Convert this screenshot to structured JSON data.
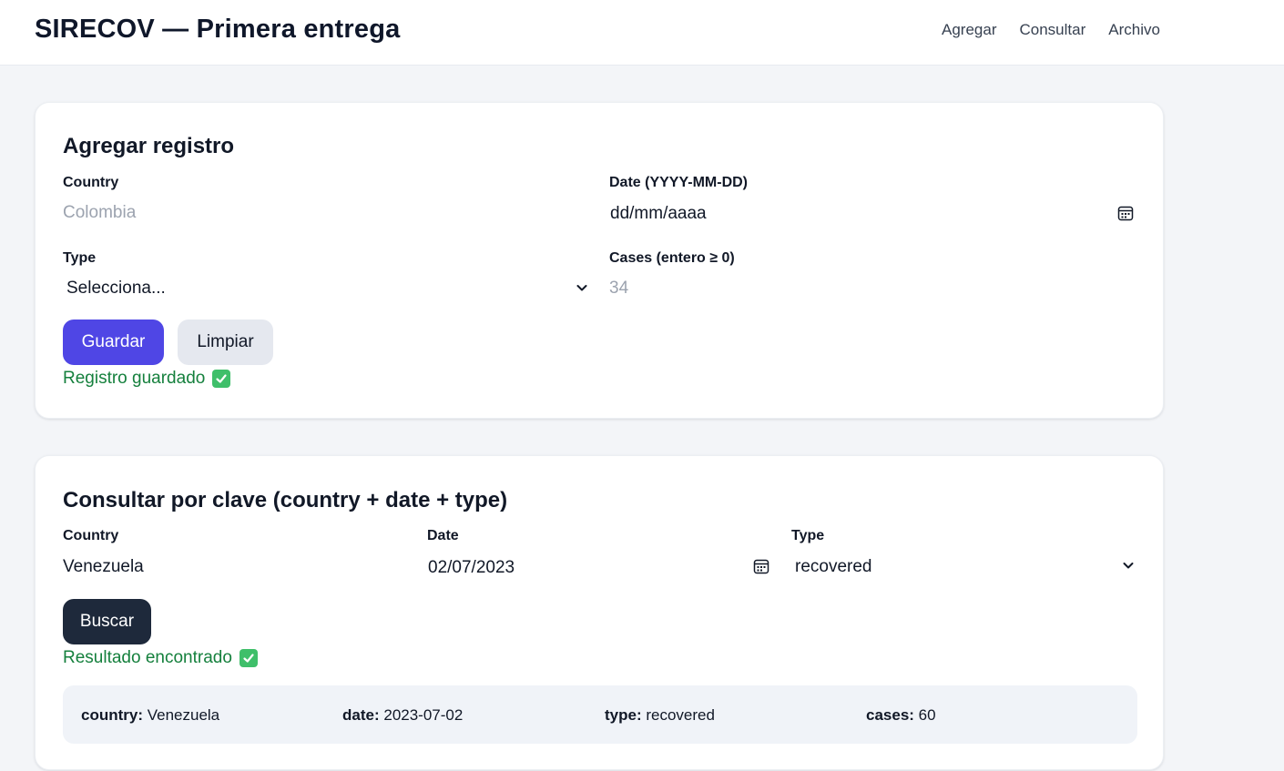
{
  "header": {
    "title": "SIRECOV — Primera entrega",
    "nav": [
      "Agregar",
      "Consultar",
      "Archivo"
    ]
  },
  "add_form": {
    "title": "Agregar registro",
    "country_label": "Country",
    "country_placeholder": "Colombia",
    "date_label": "Date (YYYY-MM-DD)",
    "date_value": "dd/mm/aaaa",
    "type_label": "Type",
    "type_selected": "Selecciona...",
    "cases_label": "Cases (entero ≥ 0)",
    "cases_placeholder": "34",
    "save_label": "Guardar",
    "clear_label": "Limpiar",
    "status_text": "Registro guardado"
  },
  "query_form": {
    "title": "Consultar por clave (country + date + type)",
    "country_label": "Country",
    "country_value": "Venezuela",
    "date_label": "Date",
    "date_value": "02/07/2023",
    "type_label": "Type",
    "type_selected": "recovered",
    "search_label": "Buscar",
    "status_text": "Resultado encontrado"
  },
  "result": {
    "country_key": "country:",
    "country_value": "Venezuela",
    "date_key": "date:",
    "date_value": "2023-07-02",
    "type_key": "type:",
    "type_value": "recovered",
    "cases_key": "cases:",
    "cases_value": "60"
  },
  "colors": {
    "primary": "#4f46e5",
    "dark": "#1e293b",
    "success": "#15803d"
  }
}
